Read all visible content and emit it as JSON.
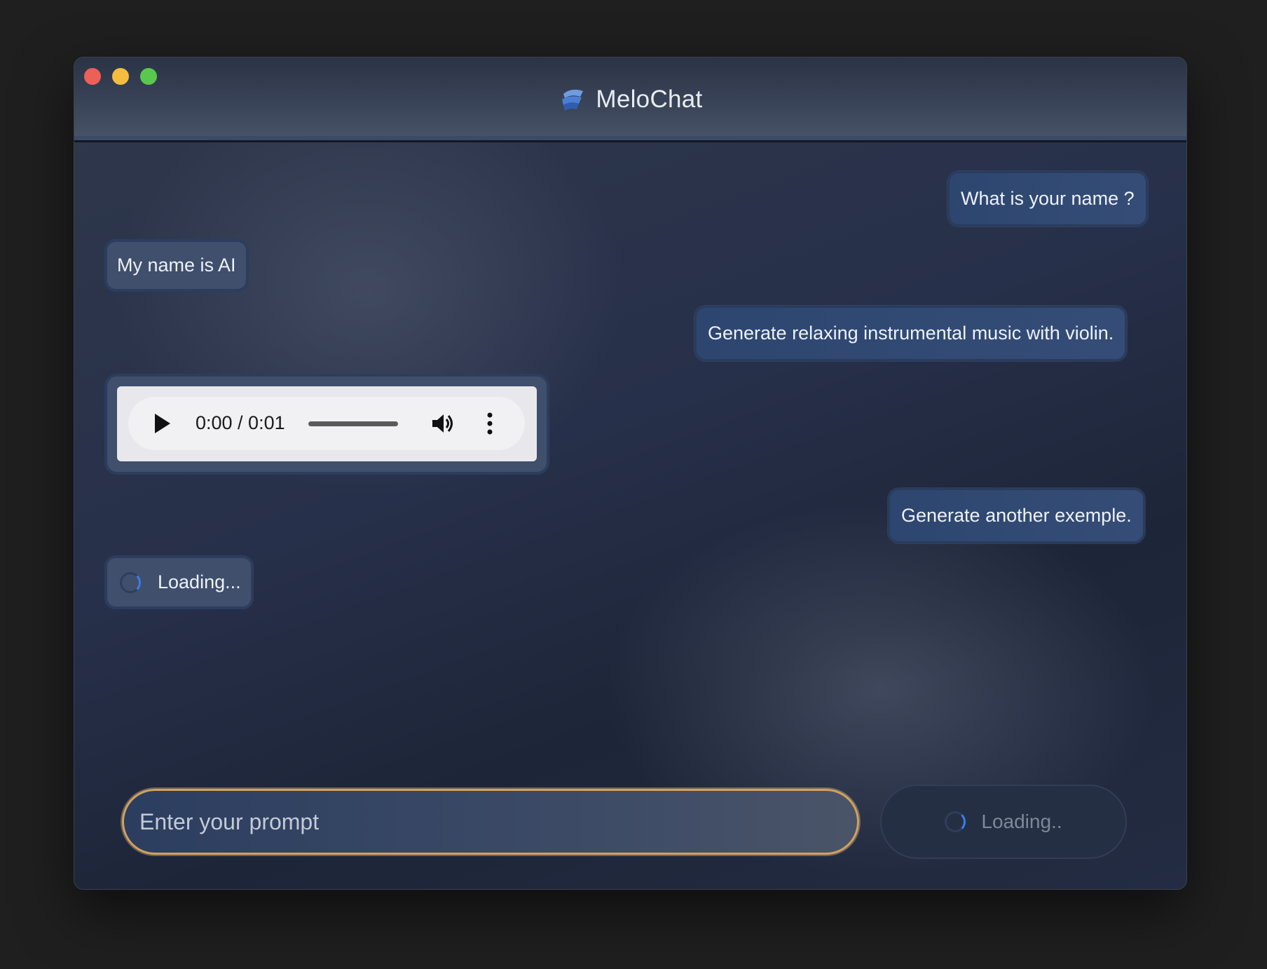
{
  "window": {
    "title": "MeloChat"
  },
  "messages": [
    {
      "role": "user",
      "text": "What is your name ?"
    },
    {
      "role": "ai",
      "text": "My name is AI"
    },
    {
      "role": "user",
      "text": "Generate relaxing instrumental music with violin."
    },
    {
      "role": "ai",
      "type": "audio",
      "time": "0:00 / 0:01"
    },
    {
      "role": "user",
      "text": "Generate another exemple."
    },
    {
      "role": "ai",
      "type": "loading",
      "text": "Loading..."
    }
  ],
  "composer": {
    "placeholder": "Enter your prompt",
    "value": "",
    "send_label": "Loading.."
  },
  "colors": {
    "accent_border": "#d3a15b",
    "spinner": "#3f7be8",
    "user_bubble": "#2d4670",
    "ai_bubble": "#3f4f6c"
  },
  "icons": {
    "logo": "melochat-logo-icon",
    "play": "play-icon",
    "volume": "volume-icon",
    "more": "more-vertical-icon"
  }
}
